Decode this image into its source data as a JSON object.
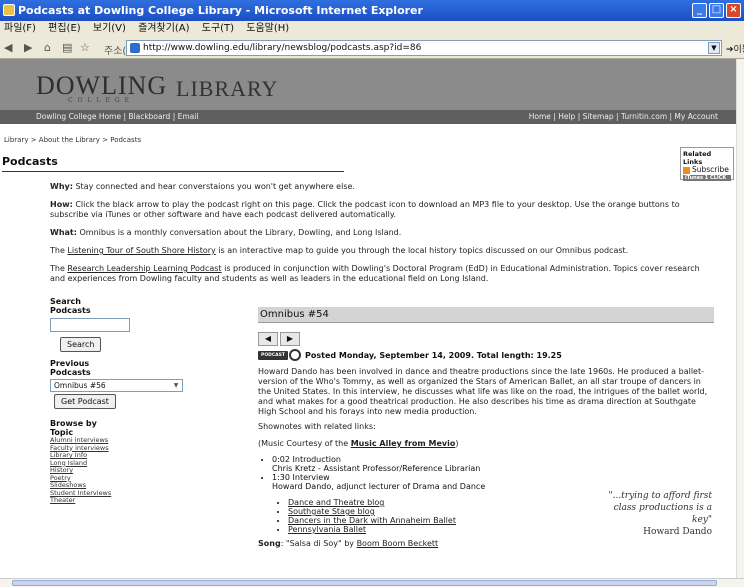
{
  "window": {
    "title": "Podcasts at Dowling College Library - Microsoft Internet Explorer",
    "menu": [
      "파일(F)",
      "편집(E)",
      "보기(V)",
      "즐겨찾기(A)",
      "도구(T)",
      "도움말(H)"
    ],
    "address_label": "주소(D)",
    "url": "http://www.dowling.edu/library/newsblog/podcasts.asp?id=86",
    "go_label": "이동"
  },
  "header": {
    "logo_word": "DOWLING",
    "logo_sub": "COLLEGE",
    "library_word": "LIBRARY",
    "nav_left": "Dowling College Home | Blackboard | Email",
    "nav_right": "Home | Help | Sitemap | Turnitin.com | My Account"
  },
  "breadcrumb": {
    "path": "Library > About the Library > ",
    "current": "Podcasts"
  },
  "page_title": "Podcasts",
  "related": {
    "heading": "Related Links",
    "subscribe": "Subscribe",
    "itunes": "iTunes 1 CLICK"
  },
  "intro": {
    "why_label": "Why:",
    "why_text": " Stay connected and hear converstaions you won't get anywhere else.",
    "how_label": "How:",
    "how_text": " Click the black arrow to play the podcast right on this page. Click the podcast icon to download an MP3 file to your desktop. Use the orange buttons to subscribe via iTunes or other software and have each podcast delivered automatically.",
    "what_label": "What:",
    "what_text": " Omnibus is a monthly conversation about the Library, Dowling, and Long Island.",
    "tour_pre": "The ",
    "tour_link": "Listening Tour of South Shore History",
    "tour_post": " is an interactive map to guide you through the local history topics discussed on our Omnibus podcast.",
    "research_pre": "The ",
    "research_link": "Research Leadership Learning Podcast",
    "research_post": " is produced in conjunction with Dowling's Doctoral Program (EdD) in Educational Administration. Topics cover research and experiences from Dowling faculty and students as well as leaders in the educational field on Long Island."
  },
  "sidebar": {
    "search_heading_1": "Search",
    "search_heading_2": "Podcasts",
    "search_value": "",
    "search_button": "Search",
    "previous_heading_1": "Previous",
    "previous_heading_2": "Podcasts",
    "previous_selected": "Omnibus #56",
    "get_button": "Get Podcast",
    "browse_heading_1": "Browse by",
    "browse_heading_2": "Topic",
    "topics": [
      "Alumni interviews",
      "Faculty interviews",
      "Library Info",
      "Long Island",
      "History",
      "Poetry",
      "Slideshows",
      "Student Interviews",
      "Theater"
    ]
  },
  "episode": {
    "title": "Omnibus #54",
    "badge": "PODCAST",
    "posted": "Posted Monday, September 14, 2009. Total length: 19.25",
    "description": "Howard Dando has been involved in dance and theatre productions since the late 1960s. He produced a ballet-version of the Who's Tommy, as well as organized the Stars of American Ballet, an all star troupe of dancers in the United States. In this interview, he discusses what life was like on the road, the intrigues of the ballet world, and what makes for a good theatrical production. He also describes his time as drama direction at Southgate High School and his forays into new media production.",
    "shownotes_label": "Shownotes with related links:",
    "music_pre": "(Music Courtesy of the ",
    "music_link": "Music Alley from Mevio",
    "music_post": ")",
    "item1_time": "0:02 Introduction",
    "item1_detail": "Chris Kretz - Assistant Professor/Reference Librarian",
    "item2_time": "1:30 Interview",
    "item2_detail": "Howard Dando, adjunct lecturer of Drama and Dance",
    "links": [
      "Dance and Theatre blog",
      "Southgate Stage blog",
      "Dancers in the Dark with Annaheim Ballet",
      "Pennsylvania Ballet"
    ],
    "song_label": "Song",
    "song_title": ": \"Salsa di Soy\" by ",
    "song_artist": "Boom Boom Beckett",
    "quote": "\"...trying to afford first class productions is a key\"",
    "quote_by": "Howard Dando"
  }
}
